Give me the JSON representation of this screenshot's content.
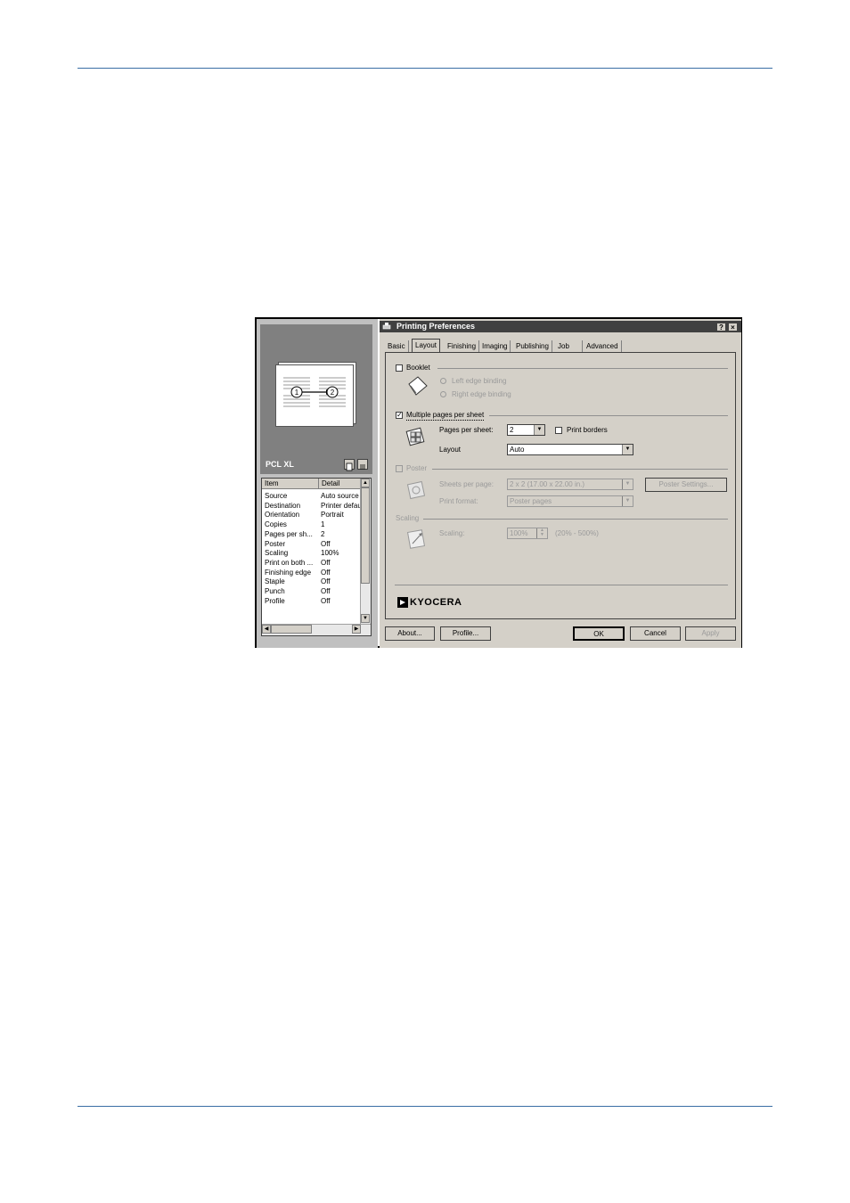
{
  "window": {
    "title": "Printing Preferences",
    "help_btn": "?",
    "close_btn": "×"
  },
  "tabs": [
    "Basic",
    "Layout",
    "Finishing",
    "Imaging",
    "Publishing",
    "Job",
    "Advanced"
  ],
  "active_tab": "Layout",
  "preview": {
    "pdl_label": "PCL XL",
    "page_numbers": [
      "1",
      "2"
    ]
  },
  "summary": {
    "columns": [
      "Item",
      "Detail"
    ],
    "rows": [
      {
        "item": "Source",
        "detail": "Auto source"
      },
      {
        "item": "Destination",
        "detail": "Printer defau"
      },
      {
        "item": "Orientation",
        "detail": "Portrait"
      },
      {
        "item": "Copies",
        "detail": "1"
      },
      {
        "item": "Pages per sh...",
        "detail": "2"
      },
      {
        "item": "Poster",
        "detail": "Off"
      },
      {
        "item": "Scaling",
        "detail": "100%"
      },
      {
        "item": "Print on both ...",
        "detail": "Off"
      },
      {
        "item": "Finishing edge",
        "detail": "Off"
      },
      {
        "item": "Staple",
        "detail": "Off"
      },
      {
        "item": "Punch",
        "detail": "Off"
      },
      {
        "item": "Profile",
        "detail": "Off"
      }
    ]
  },
  "layout": {
    "booklet": {
      "label": "Booklet",
      "checked": false,
      "left_edge": "Left edge binding",
      "right_edge": "Right edge binding"
    },
    "multiple": {
      "label": "Multiple pages per sheet",
      "checked": true,
      "pages_label": "Pages per sheet:",
      "pages_value": "2",
      "print_borders": "Print borders",
      "layout_label": "Layout",
      "layout_value": "Auto"
    },
    "poster": {
      "label": "Poster",
      "sheets_label": "Sheets per page:",
      "sheets_value": "2 x 2 (17.00 x 22.00 in.)",
      "settings_btn": "Poster Settings...",
      "format_label": "Print format:",
      "format_value": "Poster pages"
    },
    "scaling": {
      "group": "Scaling",
      "label": "Scaling:",
      "value": "100%",
      "range": "(20% - 500%)"
    },
    "brand": "KYOCERA"
  },
  "buttons": {
    "about": "About...",
    "profile": "Profile...",
    "ok": "OK",
    "cancel": "Cancel",
    "apply": "Apply"
  }
}
